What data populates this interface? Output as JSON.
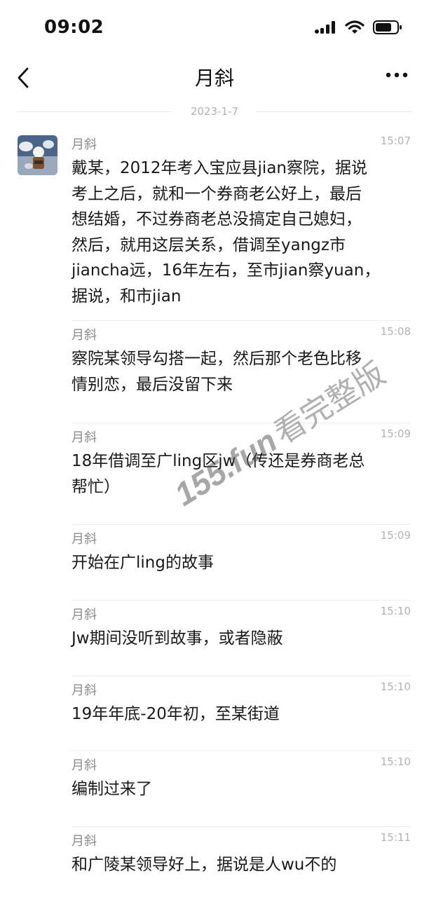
{
  "status_bar": {
    "time": "09:02"
  },
  "nav": {
    "title": "月斜"
  },
  "date_divider": "2023-1-7",
  "messages": [
    {
      "sender": "月斜",
      "time": "15:07",
      "text": "戴某，2012年考入宝应县jian察院，据说\n考上之后，就和一个券商老公好上，最后\n想结婚，不过券商老总没搞定自己媳妇，\n然后，就用这层关系，借调至yangz市\njiancha远，16年左右，至市jian察yuan，\n据说，和市jian"
    },
    {
      "sender": "月斜",
      "time": "15:08",
      "text": "察院某领导勾搭一起，然后那个老色比移\n情别恋，最后没留下来"
    },
    {
      "sender": "月斜",
      "time": "15:09",
      "text": "18年借调至广ling区jw（传还是券商老总\n帮忙）"
    },
    {
      "sender": "月斜",
      "time": "15:09",
      "text": "开始在广ling的故事"
    },
    {
      "sender": "月斜",
      "time": "15:10",
      "text": "Jw期间没听到故事，或者隐蔽"
    },
    {
      "sender": "月斜",
      "time": "15:10",
      "text": "19年年底-20年初，至某街道"
    },
    {
      "sender": "月斜",
      "time": "15:10",
      "text": "编制过来了"
    },
    {
      "sender": "月斜",
      "time": "15:11",
      "text": "和广陵某领导好上，据说是人wu不的"
    }
  ],
  "watermark": {
    "site": "155.fun",
    "text": "看完整版"
  },
  "colors": {
    "background": "#ffffff",
    "text": "#191919",
    "meta": "#b2b2b2",
    "sender": "#8c8c8c",
    "divider": "#ececec"
  },
  "icons": [
    "signal-icon",
    "wifi-icon",
    "battery-icon",
    "back-arrow-icon",
    "more-icon",
    "avatar-image"
  ]
}
